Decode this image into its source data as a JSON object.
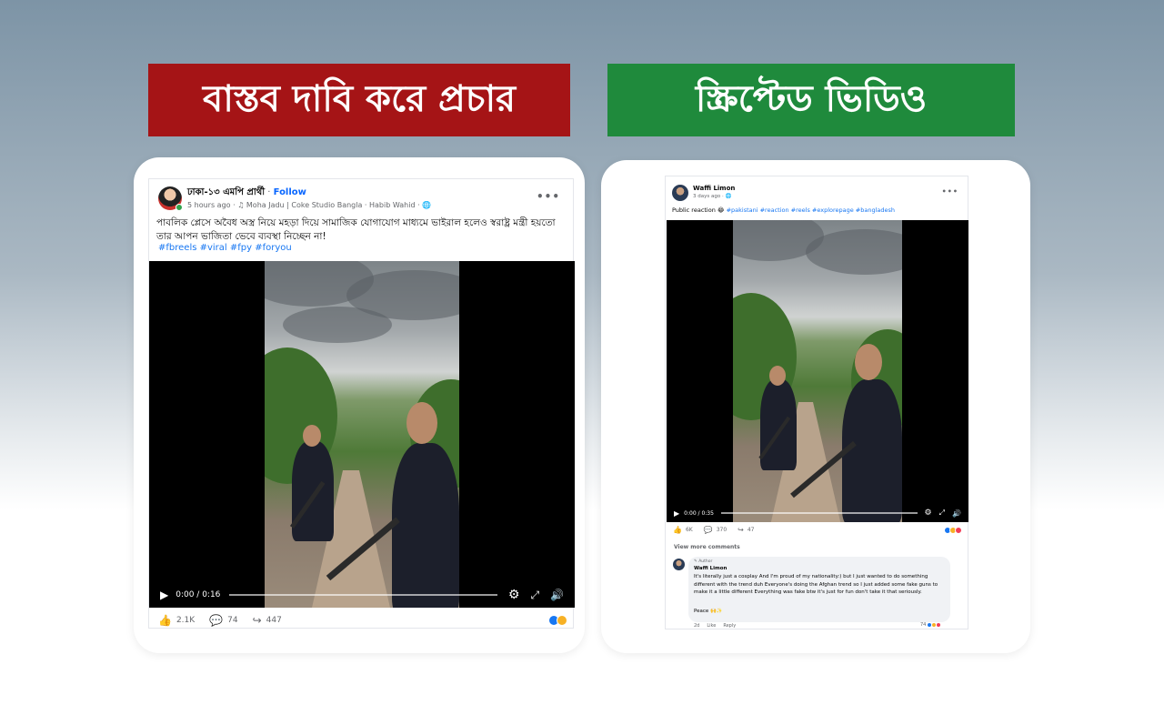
{
  "banners": {
    "left": "বাস্তব দাবি করে প্রচার",
    "right": "স্ক্রিপ্টেড ভিডিও"
  },
  "left_post": {
    "author": "ঢাকা-১৩ এমপি প্রার্থী",
    "separator": "·",
    "follow": "Follow",
    "time": "5 hours ago",
    "audio": "♫ Moha Jadu | Coke Studio Bangla · Habib Wahid · ",
    "globe_icon": "globe-icon",
    "text": "পাবলিক প্লেসে অবৈধ অস্ত্র নিয়ে মহড়া দিয়ে সামাজিক যোগাযোগ মাধ্যমে ভাইরাল হলেও স্বরাষ্ট্র মন্ত্রী হয়তো তার আপন ভাজিতা ভেবে ব্যবস্থা নিচ্ছেন না!",
    "hashtags": "#fbreels #viral #fpy #foryou",
    "video_time": "0:00 / 0:16",
    "likes": "2.1K",
    "comments": "74",
    "shares": "447"
  },
  "right_post": {
    "author": "Waffi Limon",
    "time": "3 days ago · ",
    "caption": "Public reaction 😂 ",
    "hashtags": "#pakistani #reaction #reels #explorepage #bangladesh",
    "video_time": "0:00 / 0:35",
    "likes": "6K",
    "comments": "370",
    "shares": "47",
    "view_more": "View more comments",
    "comment": {
      "badge": "✎ Author",
      "author": "Waffi Limon",
      "text": "It's literally just a cosplay And I'm proud of my nationality:) but I just wanted to do something different with the trend duh Everyone's doing the Afghan trend so I just added some fake guns to make it a little different Everything was fake btw it's just for fun don't take it that seriously.",
      "peace": "Peace 🙌✨",
      "age": "2d",
      "like": "Like",
      "reply": "Reply",
      "reactions": "74"
    }
  },
  "colors": {
    "red": "#a51416",
    "green": "#1f8a3c",
    "fb_blue": "#1877f2"
  }
}
